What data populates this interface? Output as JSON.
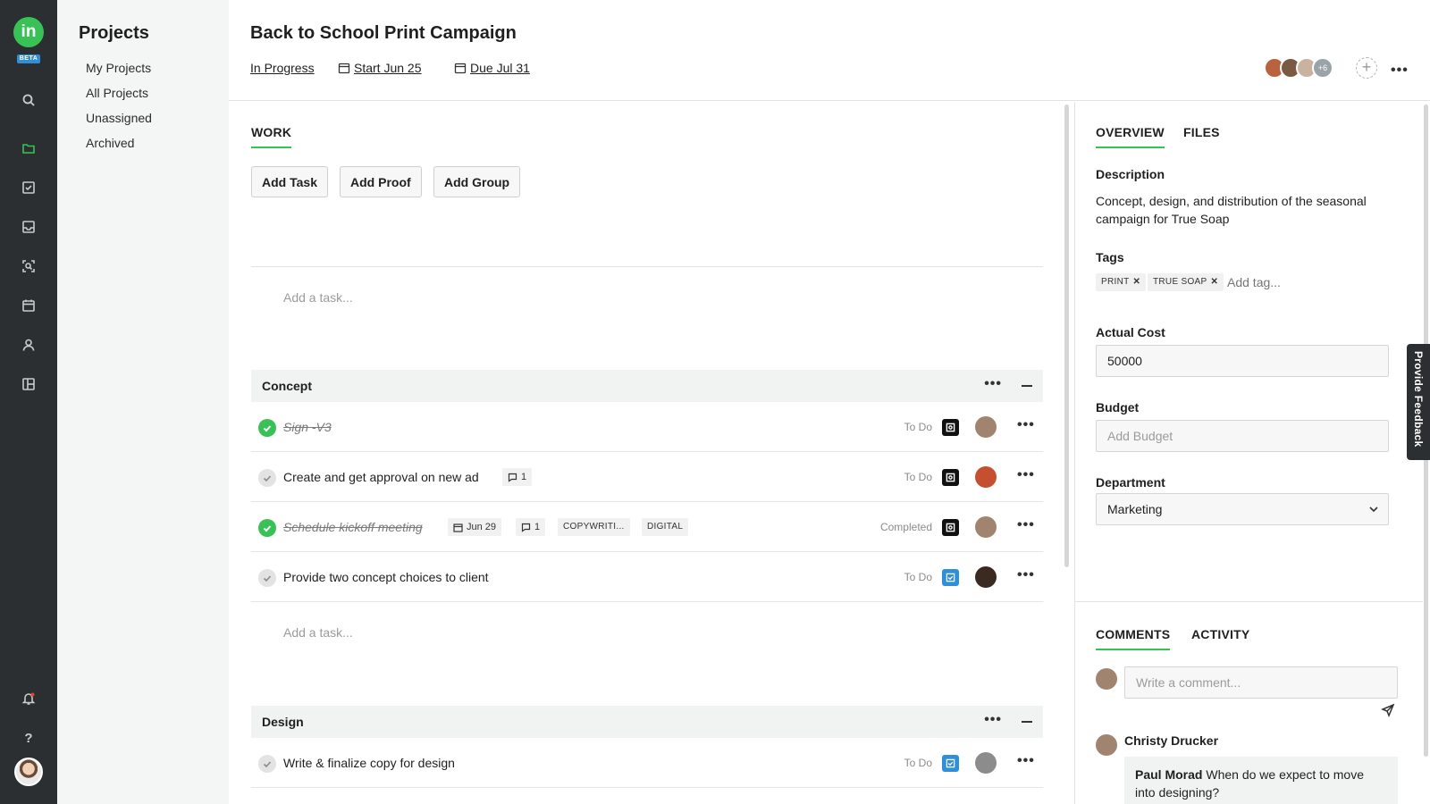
{
  "app": {
    "logo_text": "in",
    "beta_label": "BETA"
  },
  "colors": {
    "accent": "#38c256",
    "rail_bg": "#2b2f31",
    "proof_icon": "#111111",
    "task_icon": "#2f8fd8"
  },
  "rail": {
    "icons": [
      "search-icon",
      "folder-icon",
      "task-check-icon",
      "inbox-icon",
      "proof-search-icon",
      "calendar-icon",
      "person-icon",
      "layout-icon",
      "notification-bell-icon",
      "help-icon"
    ]
  },
  "projects_nav": {
    "title": "Projects",
    "items": [
      "My Projects",
      "All Projects",
      "Unassigned",
      "Archived"
    ]
  },
  "project": {
    "title": "Back to School Print Campaign",
    "status": "In Progress",
    "start": "Start Jun 25",
    "due": "Due Jul 31",
    "members_more": "+6",
    "add_member": "+"
  },
  "work": {
    "tab": "WORK",
    "buttons": {
      "add_task": "Add Task",
      "add_proof": "Add Proof",
      "add_group": "Add Group"
    },
    "add_task_placeholder": "Add a task...",
    "groups": [
      {
        "name": "Concept",
        "tasks": [
          {
            "name": "Sign -V3",
            "status": "To Do",
            "done": true
          },
          {
            "name": "Create and get approval on new ad",
            "comments": "1",
            "status": "To Do",
            "done": false
          },
          {
            "name": "Schedule kickoff meeting",
            "date": "Jun 29",
            "comments": "1",
            "tags": [
              "COPYWRITI...",
              "DIGITAL"
            ],
            "status": "Completed",
            "done": true
          },
          {
            "name": "Provide two concept choices to client",
            "status": "To Do",
            "done": false
          }
        ]
      },
      {
        "name": "Design",
        "tasks": [
          {
            "name": "Write & finalize copy for design",
            "status": "To Do",
            "done": false
          }
        ]
      }
    ]
  },
  "overview": {
    "tabs": [
      "OVERVIEW",
      "FILES"
    ],
    "description_label": "Description",
    "description": "Concept, design, and distribution of the seasonal campaign for True Soap",
    "tags_label": "Tags",
    "tags": [
      "PRINT",
      "TRUE SOAP"
    ],
    "tag_remove": "✕",
    "add_tag_placeholder": "Add tag...",
    "actual_cost_label": "Actual Cost",
    "actual_cost": "50000",
    "budget_label": "Budget",
    "budget_placeholder": "Add Budget",
    "department_label": "Department",
    "department": "Marketing"
  },
  "comments": {
    "tabs": [
      "COMMENTS",
      "ACTIVITY"
    ],
    "input_placeholder": "Write a comment...",
    "items": [
      {
        "author": "Christy Drucker",
        "mention": "Paul Morad",
        "text": "When do we expect to move into designing?"
      }
    ]
  },
  "feedback": {
    "label": "Provide Feedback"
  },
  "more_dots": "•••"
}
